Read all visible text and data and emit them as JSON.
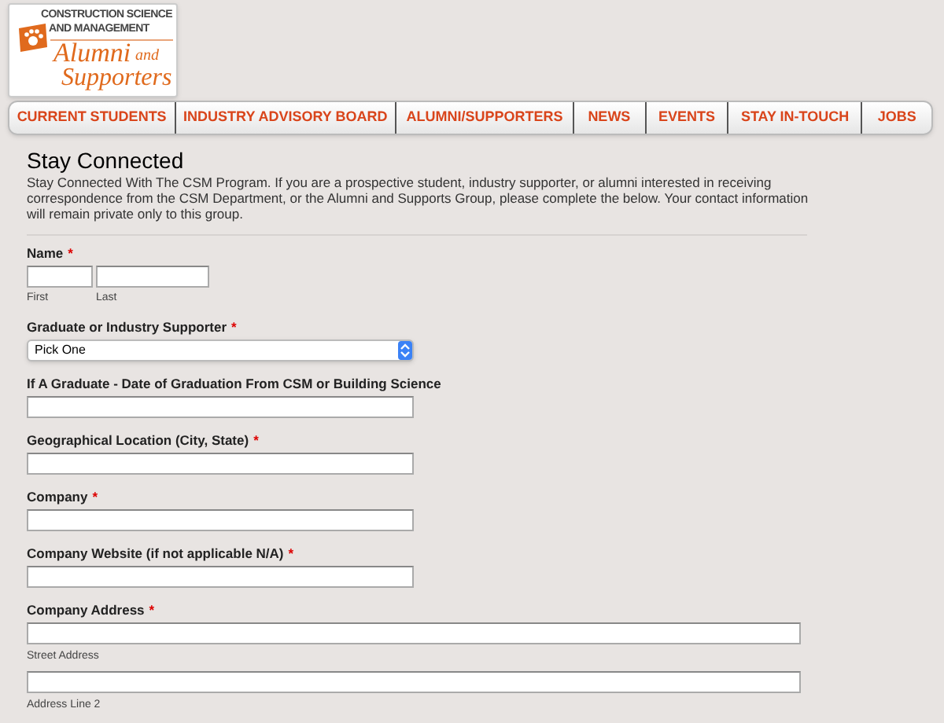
{
  "logo": {
    "line_1": "CONSTRUCTION SCIENCE",
    "line_2": "AND MANAGEMENT",
    "script_1": "Alumni",
    "script_2": "and",
    "script_3": "Supporters"
  },
  "nav": [
    {
      "label": "CURRENT STUDENTS"
    },
    {
      "label": "INDUSTRY ADVISORY BOARD"
    },
    {
      "label": "ALUMNI/SUPPORTERS"
    },
    {
      "label": "NEWS"
    },
    {
      "label": "EVENTS"
    },
    {
      "label": "STAY IN-TOUCH"
    },
    {
      "label": "JOBS"
    }
  ],
  "form": {
    "title": "Stay Connected",
    "description": "Stay Connected With The CSM Program. If you are a prospective student, industry supporter, or alumni interested in receiving correspondence from the CSM Department, or the Alumni and Supports Group, please complete the below. Your contact information will remain private only to this group.",
    "fields": [
      {
        "kind": "name",
        "label": "Name",
        "required_mark": "*",
        "sublabels": [
          "First",
          "Last"
        ]
      },
      {
        "kind": "select",
        "label": "Graduate or Industry Supporter",
        "required_mark": "*",
        "value": "Pick One"
      },
      {
        "kind": "text",
        "label": "If A Graduate - Date of Graduation From CSM or Building Science"
      },
      {
        "kind": "text",
        "label": "Geographical Location (City, State)",
        "required_mark": "*"
      },
      {
        "kind": "text",
        "label": "Company",
        "required_mark": "*"
      },
      {
        "kind": "text",
        "label": "Company Website (if not applicable N/A)",
        "required_mark": "*"
      },
      {
        "kind": "address",
        "label": "Company Address",
        "required_mark": "*",
        "sublabels": [
          "Street Address",
          "Address Line 2"
        ]
      }
    ]
  }
}
